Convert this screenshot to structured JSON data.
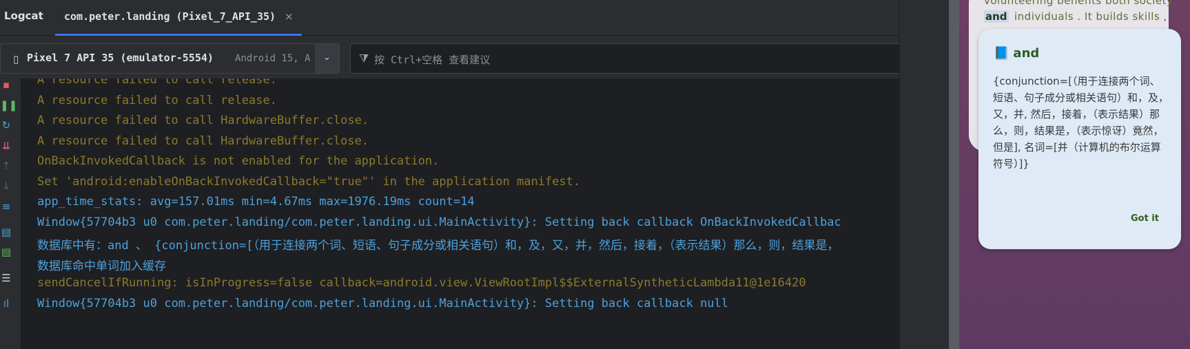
{
  "tabs": {
    "title": "Logcat",
    "active_tab_label": "com.peter.landing (Pixel_7_API_35)",
    "close_glyph": "×"
  },
  "toolbar": {
    "device_name": "Pixel 7 API 35 (emulator-5554)",
    "device_os": "Android 15, A",
    "filter_placeholder": "按 Ctrl+空格 查看建议"
  },
  "sidebar_icons": [
    "trash-icon",
    "pause-icon",
    "restart-icon",
    "scroll-to-end-icon",
    "up-arrow-icon",
    "down-arrow-icon",
    "soft-wrap-icon",
    "file-icon",
    "file-export-icon",
    "list-icon",
    "waveform-icon"
  ],
  "colors": {
    "warn": "#8c7a2a",
    "info": "#4da1dc",
    "accent": "#3574f0"
  },
  "log_lines": [
    {
      "text": "A resource failed to call release.",
      "level": "warn"
    },
    {
      "text": "A resource failed to call release.",
      "level": "warn"
    },
    {
      "text": "A resource failed to call HardwareBuffer.close.",
      "level": "warn"
    },
    {
      "text": "A resource failed to call HardwareBuffer.close.",
      "level": "warn"
    },
    {
      "text": "OnBackInvokedCallback is not enabled for the application.",
      "level": "warn"
    },
    {
      "text": "Set 'android:enableOnBackInvokedCallback=\"true\"' in the application manifest.",
      "level": "warn"
    },
    {
      "text": "app_time_stats: avg=157.01ms min=4.67ms max=1976.19ms count=14",
      "level": "info"
    },
    {
      "text": "Window{57704b3 u0 com.peter.landing/com.peter.landing.ui.MainActivity}: Setting back callback OnBackInvokedCallbac",
      "level": "info"
    },
    {
      "text": "数据库中有：and 、 {conjunction=[（用于连接两个词、短语、句子成分或相关语句）和，及，又，并，然后，接着，（表示结果）那么，则，结果是，",
      "level": "info"
    },
    {
      "text": "数据库命中单词加入缓存",
      "level": "info"
    },
    {
      "text": "sendCancelIfRunning: isInProgress=false callback=android.view.ViewRootImpl$$ExternalSyntheticLambda11@1e16420",
      "level": "warn"
    },
    {
      "text": "Window{57704b3 u0 com.peter.landing/com.peter.landing.ui.MainActivity}: Setting back callback null",
      "level": "info"
    }
  ],
  "phone": {
    "bg_line_1": "volunteering benefits both society",
    "highlight_word": "and",
    "bg_line_2": "individuals . It builds skills ,",
    "dialog": {
      "title_icon": "📘",
      "title": "and",
      "body": "{conjunction=[（用于连接两个词、短语、句子成分或相关语句）和，及，又，并, 然后，接着，（表示结果）那么，则，结果是，（表示惊讶）竟然，但是], 名词=[并（计算机的布尔运算符号）]}",
      "button": "Got it"
    }
  }
}
